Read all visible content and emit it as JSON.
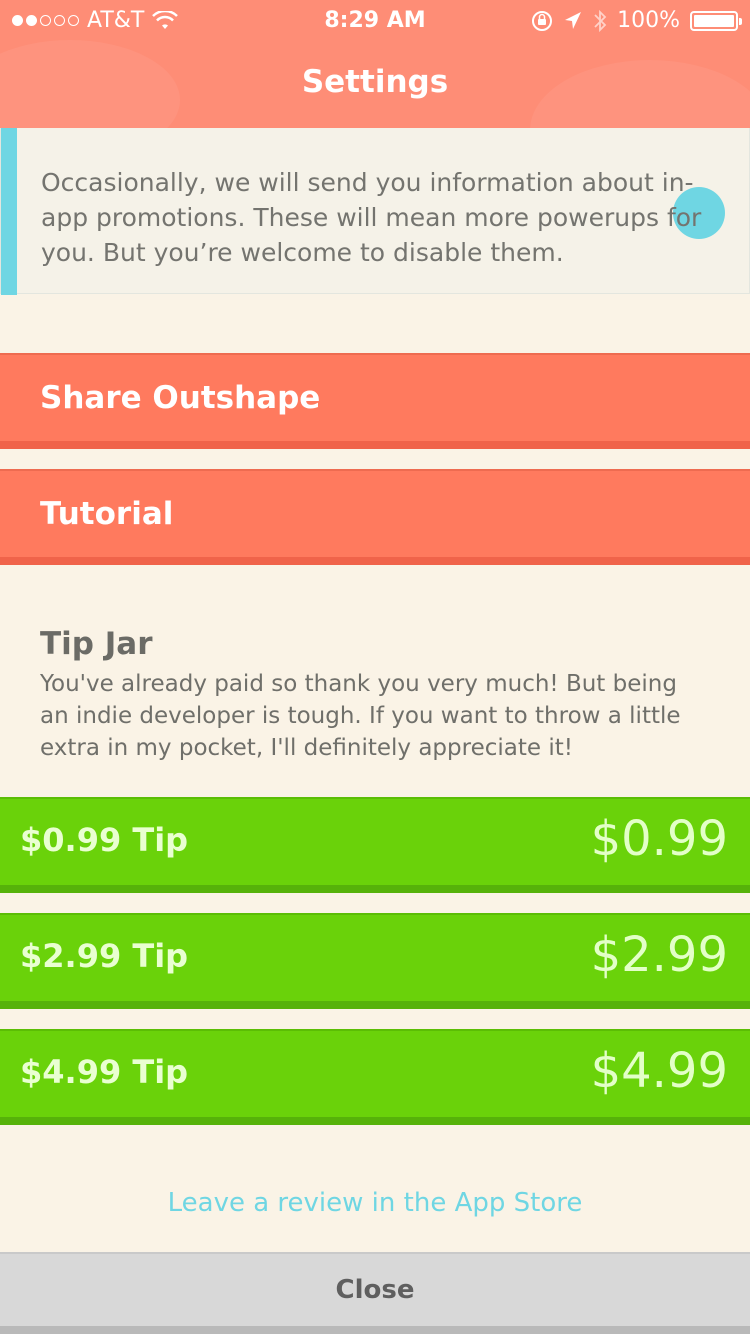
{
  "status_bar": {
    "carrier": "AT&T",
    "time": "8:29 AM",
    "battery": "100%",
    "signal_dots_on": 2,
    "signal_dots_total": 5
  },
  "header": {
    "title": "Settings"
  },
  "promo": {
    "text": "Occasionally, we will send you information about in-app promotions. These will mean more powerups for you. But you’re welcome to disable them.",
    "accent_color": "#6fd6e3"
  },
  "actions": {
    "share": "Share Outshape",
    "tutorial": "Tutorial"
  },
  "tip_jar": {
    "title": "Tip Jar",
    "text": "You've already paid so thank you very much! But being an indie developer is tough. If you want to throw a little extra in my pocket, I'll definitely appreciate it!",
    "tips": [
      {
        "label": "$0.99 Tip",
        "price": "$0.99"
      },
      {
        "label": "$2.99 Tip",
        "price": "$2.99"
      },
      {
        "label": "$4.99 Tip",
        "price": "$4.99"
      }
    ]
  },
  "review_link": "Leave a review in the App Store",
  "close_label": "Close",
  "colors": {
    "header": "#fe8d76",
    "salmon_button": "#ff7a5e",
    "tip_green": "#6ad20a",
    "link_cyan": "#6fd6e3",
    "background": "#faf3e6"
  },
  "icons": [
    "wifi-icon",
    "orientation-lock-icon",
    "location-arrow-icon",
    "bluetooth-icon",
    "battery-icon"
  ]
}
